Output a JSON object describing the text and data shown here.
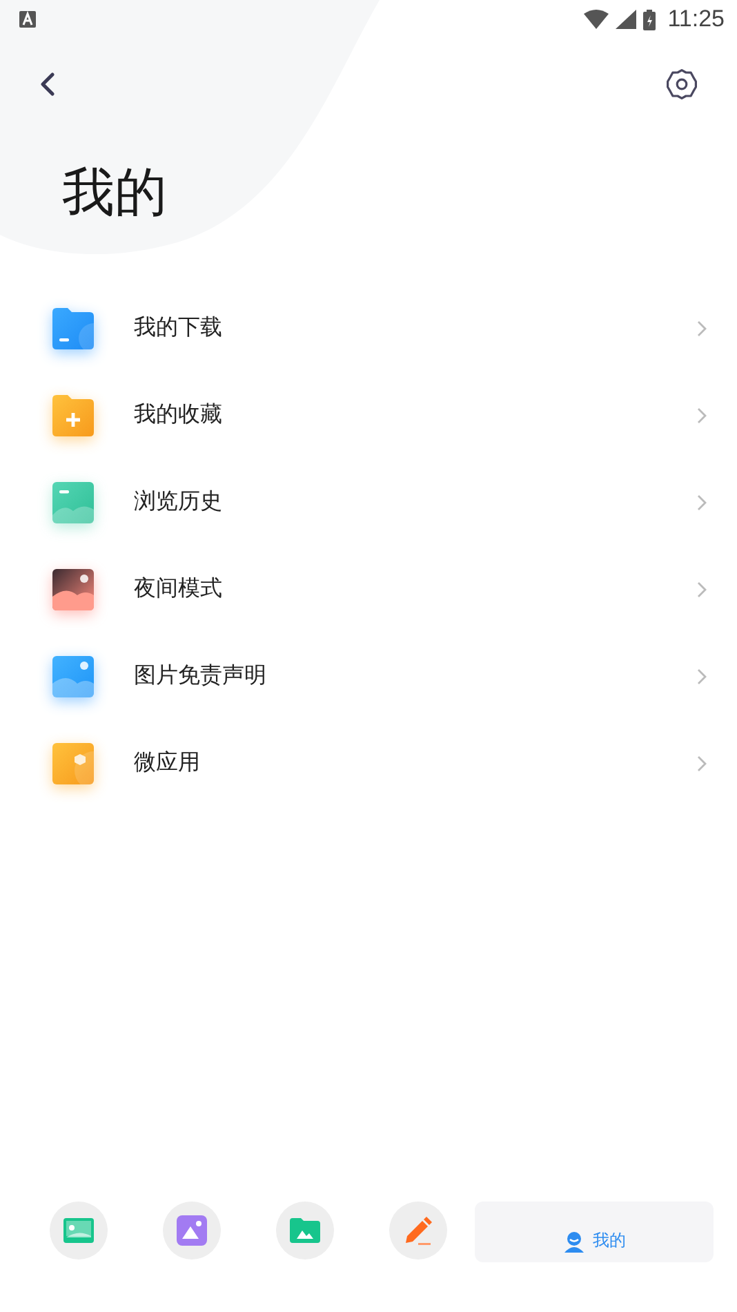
{
  "status_bar": {
    "time": "11:25"
  },
  "header": {
    "title": "我的"
  },
  "menu": [
    {
      "label": "我的下载"
    },
    {
      "label": "我的收藏"
    },
    {
      "label": "浏览历史"
    },
    {
      "label": "夜间模式"
    },
    {
      "label": "图片免责声明"
    },
    {
      "label": "微应用"
    }
  ],
  "bottom_nav": [
    {
      "selected": false
    },
    {
      "selected": false
    },
    {
      "selected": false
    },
    {
      "selected": false
    },
    {
      "label": "我的",
      "selected": true
    }
  ]
}
